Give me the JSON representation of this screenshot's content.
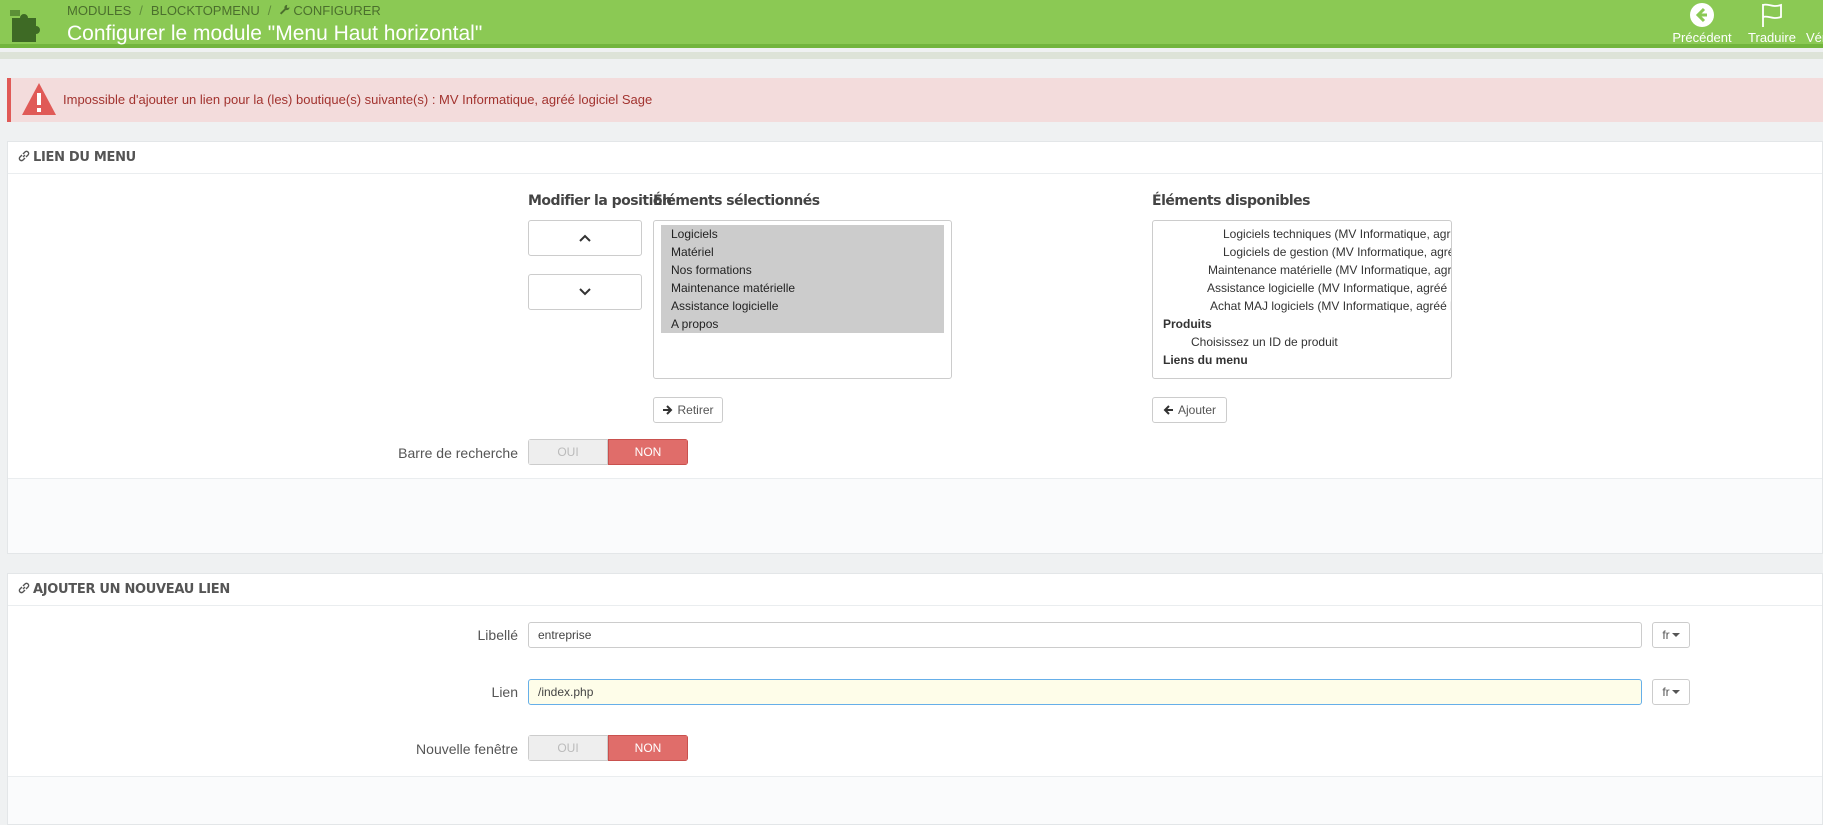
{
  "header": {
    "breadcrumb": [
      "MODULES",
      "BLOCKTOPMENU",
      "CONFIGURER"
    ],
    "title": "Configurer le module \"Menu Haut horizontal\"",
    "toolbar": {
      "back": "Précédent",
      "translate": "Traduire",
      "check": "Vér"
    }
  },
  "alert": {
    "message": "Impossible d'ajouter un lien pour la (les) boutique(s) suivante(s) : MV Informatique, agréé logiciel Sage"
  },
  "menu_panel": {
    "heading": "LIEN DU MENU",
    "position_label": "Modifier la position",
    "selected_label": "Éléments sélectionnés",
    "available_label": "Éléments disponibles",
    "selected_items": [
      "Logiciels",
      "Matériel",
      "Nos formations",
      "Maintenance matérielle",
      "Assistance logicielle",
      "A propos"
    ],
    "available_items": [
      {
        "text": "Logiciels techniques (MV Informatique, agréé logiciel Sage)",
        "kind": "item"
      },
      {
        "text": "Logiciels de gestion (MV Informatique, agréé logiciel Sage)",
        "kind": "item"
      },
      {
        "text": "Maintenance matérielle (MV Informatique, agréé logiciel Sage)",
        "kind": "item"
      },
      {
        "text": "Assistance logicielle (MV Informatique, agréé logiciel Sage)",
        "kind": "item"
      },
      {
        "text": "Achat MAJ logiciels (MV Informatique, agréé logiciel Sage)",
        "kind": "item"
      },
      {
        "text": "Produits",
        "kind": "group"
      },
      {
        "text": "Choisissez un ID de produit",
        "kind": "sub"
      },
      {
        "text": "Liens du menu",
        "kind": "group"
      }
    ],
    "remove_label": "Retirer",
    "add_label": "Ajouter",
    "search_bar_label": "Barre de recherche",
    "toggle_yes": "OUI",
    "toggle_no": "NON"
  },
  "new_link_panel": {
    "heading": "AJOUTER UN NOUVEAU LIEN",
    "label_field": {
      "label": "Libellé",
      "value": "entreprise",
      "lang": "fr"
    },
    "link_field": {
      "label": "Lien",
      "value": "/index.php",
      "lang": "fr"
    },
    "new_window_label": "Nouvelle fenêtre",
    "toggle_yes": "OUI",
    "toggle_no": "NON"
  }
}
